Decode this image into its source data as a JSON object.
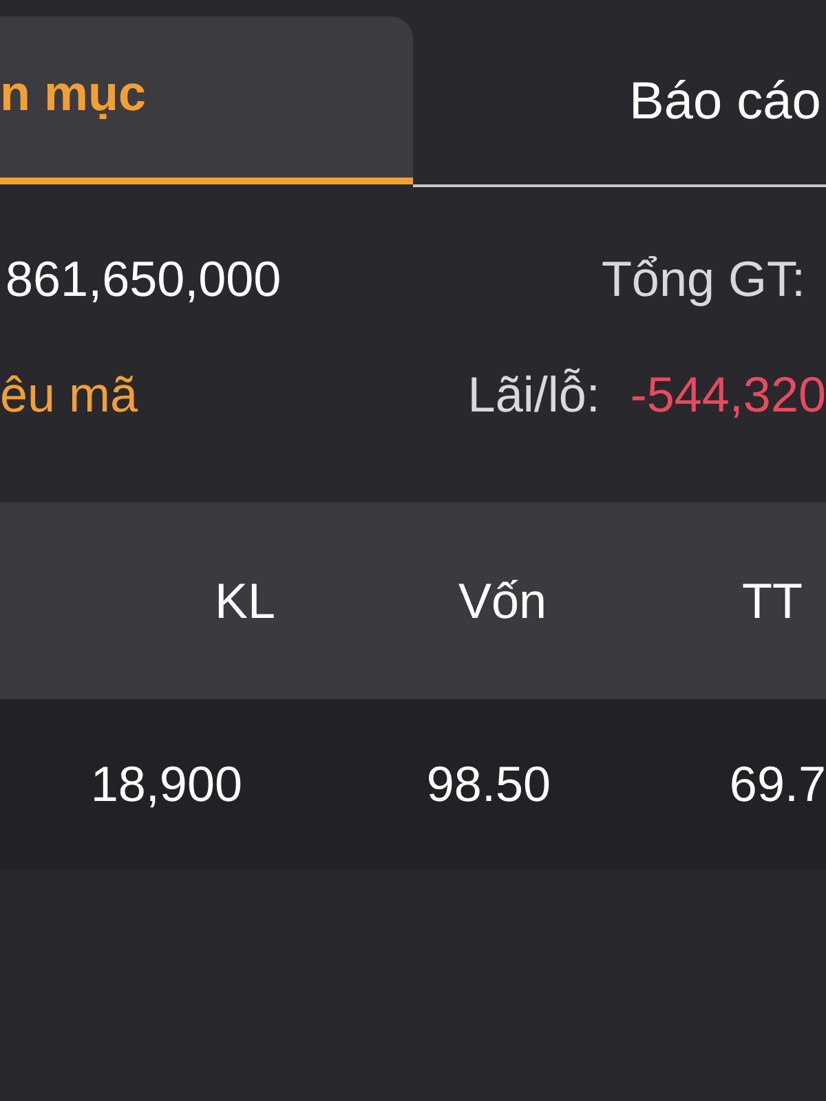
{
  "tabs": [
    {
      "label": "n mục",
      "selected": true
    },
    {
      "label": "Báo cáo",
      "selected": false
    }
  ],
  "summary": {
    "left_value": "861,650,000",
    "total_label": "Tổng GT:",
    "link": "êu mã",
    "profit_loss": {
      "label": "Lãi/lỗ:",
      "value": "-544,320",
      "loss": true
    }
  },
  "table": {
    "columns": [
      "KL",
      "Vốn",
      "TT"
    ],
    "rows": [
      [
        "18,900",
        "98.50",
        "69.7"
      ]
    ]
  }
}
